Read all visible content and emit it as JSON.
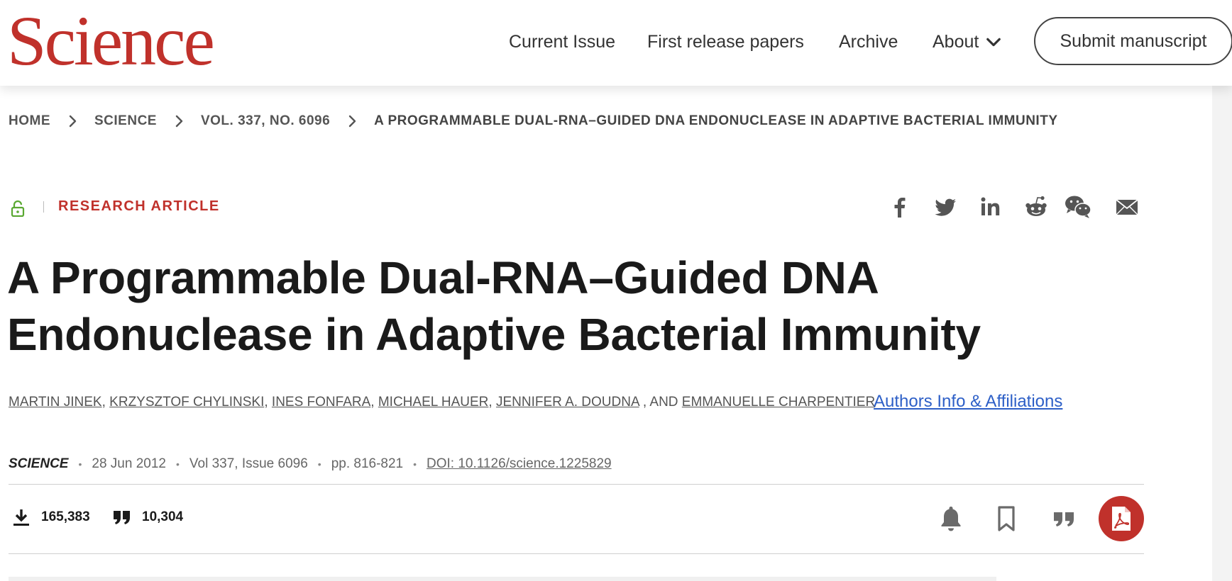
{
  "header": {
    "logo_text": "Science",
    "nav": {
      "current_issue": "Current Issue",
      "first_release": "First release papers",
      "archive": "Archive",
      "about": "About"
    },
    "submit_label": "Submit manuscript"
  },
  "breadcrumb": {
    "home": "HOME",
    "science": "SCIENCE",
    "volume": "VOL. 337, NO. 6096",
    "current": "A PROGRAMMABLE DUAL-RNA–GUIDED DNA ENDONUCLEASE IN ADAPTIVE BACTERIAL IMMUNITY"
  },
  "article": {
    "type": "RESEARCH ARTICLE",
    "title": "A Programmable Dual-RNA–Guided DNA Endonuclease in Adaptive Bacterial Immunity",
    "authors": [
      "MARTIN JINEK",
      "KRZYSZTOF CHYLINSKI",
      "INES FONFARA",
      "MICHAEL HAUER",
      "JENNIFER A. DOUDNA",
      "EMMANUELLE CHARPENTIER"
    ],
    "authors_conjunction": ", AND",
    "affiliations_link": "Authors Info & Affiliations",
    "meta": {
      "journal": "SCIENCE",
      "date": "28 Jun 2012",
      "volume_issue": "Vol 337, Issue 6096",
      "pages": "pp. 816-821",
      "doi": "DOI: 10.1126/science.1225829"
    },
    "metrics": {
      "downloads": "165,383",
      "citations": "10,304"
    }
  },
  "share_icons": [
    "facebook-icon",
    "twitter-icon",
    "linkedin-icon",
    "reddit-icon",
    "wechat-icon",
    "email-icon"
  ],
  "colors": {
    "brand_red": "#c0312b",
    "link_blue": "#2d5fc7",
    "open_access_green": "#5aa832"
  }
}
